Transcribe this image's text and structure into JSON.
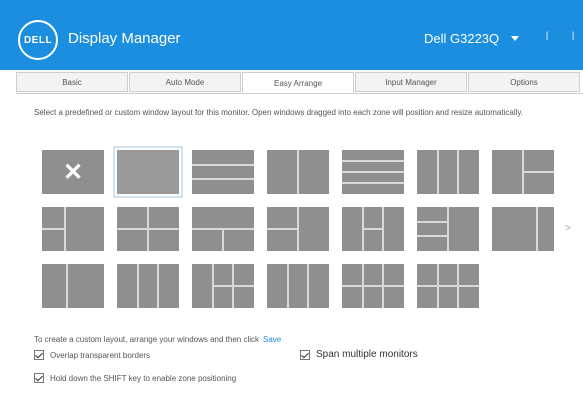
{
  "app": {
    "title": "Display Manager",
    "logo_text": "DELL",
    "monitor": "Dell G3223Q",
    "accent_color": "#1c8ee0"
  },
  "tabs": [
    {
      "label": "Basic",
      "active": false
    },
    {
      "label": "Auto Mode",
      "active": false
    },
    {
      "label": "Easy Arrange",
      "active": true
    },
    {
      "label": "Input Manager",
      "active": false
    },
    {
      "label": "Options",
      "active": false
    }
  ],
  "description": "Select a predefined or custom window layout for this monitor. Open windows dragged into each zone will position and resize automatically.",
  "layouts": {
    "selected_index": 1,
    "more_indicator": ">"
  },
  "footer": {
    "hint": "To create a custom layout, arrange your windows and then click",
    "save_link": "Save",
    "options": [
      {
        "label": "Overlap transparent borders",
        "checked": true
      },
      {
        "label": "Span multiple monitors",
        "checked": true
      },
      {
        "label": "Hold down the SHIFT key to enable zone positioning",
        "checked": true
      }
    ]
  }
}
